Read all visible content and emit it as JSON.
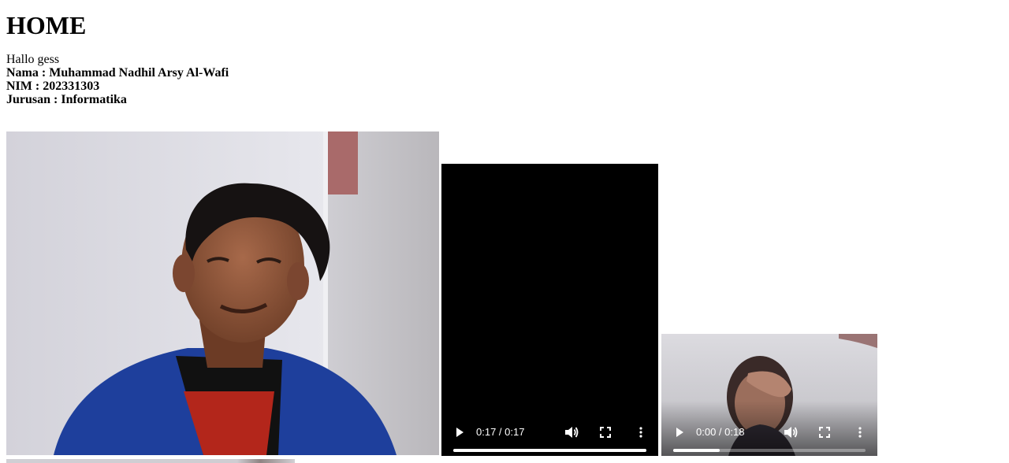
{
  "page": {
    "title": "HOME",
    "greeting": "Hallo gess",
    "nama": "Nama : Muhammad Nadhil Arsy Al-Wafi",
    "nim": "NIM : 202331303",
    "jurusan": "Jurusan : Informatika"
  },
  "videos": [
    {
      "time": "0:17 / 0:17",
      "progress": 1.0,
      "poster": "black"
    },
    {
      "time": "0:00 / 0:18",
      "progress": 0.24,
      "poster": "person-covering-face"
    }
  ],
  "icons": {
    "play": "play-icon",
    "volume": "volume-icon",
    "fullscreen": "fullscreen-icon",
    "menu": "more-vert-icon"
  },
  "colors": {
    "jacket": "#1c3f9e",
    "shirt": "#b8261a",
    "wall": "#dcdbe2"
  }
}
